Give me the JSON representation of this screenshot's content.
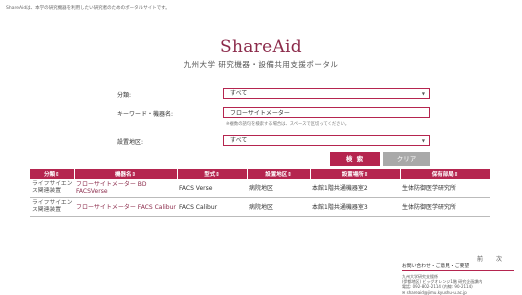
{
  "top_note": "ShareAidは、本学の研究機器を利用したい研究者のためのポータルサイトです。",
  "brand": {
    "title": "ShareAid",
    "subtitle": "九州大学 研究機器・設備共用支援ポータル"
  },
  "form": {
    "category_label": "分類:",
    "category_value": "すべて",
    "keyword_label": "キーワード・機器名:",
    "keyword_value": "フローサイトメーター",
    "keyword_hint": "※複数の語句を検索する場合は、スペースで区切ってください。",
    "area_label": "設置地区:",
    "area_value": "すべて",
    "search_label": "検 索",
    "clear_label": "クリア"
  },
  "table": {
    "headers": [
      "分類⇕",
      "機器名⇕",
      "型式⇕",
      "設置地区⇕",
      "設置場所⇕",
      "保有部局⇕"
    ],
    "rows": [
      {
        "category": "ライフサイエンス関連装置",
        "name": "フローサイトメーター BD FACSVerse",
        "model": "FACS Verse",
        "area": "病院地区",
        "place": "本館1階共通機器室2",
        "dept": "生体防御医学研究所"
      },
      {
        "category": "ライフサイエンス関連装置",
        "name": "フローサイトメーター FACS Calibur",
        "model": "FACS Calibur",
        "area": "病院地区",
        "place": "本館1階共通機器室3",
        "dept": "生体防御医学研究所"
      }
    ]
  },
  "pager": {
    "prev": "前",
    "next": "次"
  },
  "contact": {
    "title": "お問い合わせ・ご意見・ご要望",
    "lines": [
      "九州大学研究支援係",
      "(伊都地区) ビッグオレンジ1階 研究企画課内",
      "電話: 092-802-2114 (内線: 90-2114)",
      "✉ shareaid@jimu.kyushu-u.ac.jp"
    ]
  },
  "colors": {
    "accent": "#b5254f",
    "brand": "#8b2a4a",
    "clear_button": "#a9a9a9"
  }
}
